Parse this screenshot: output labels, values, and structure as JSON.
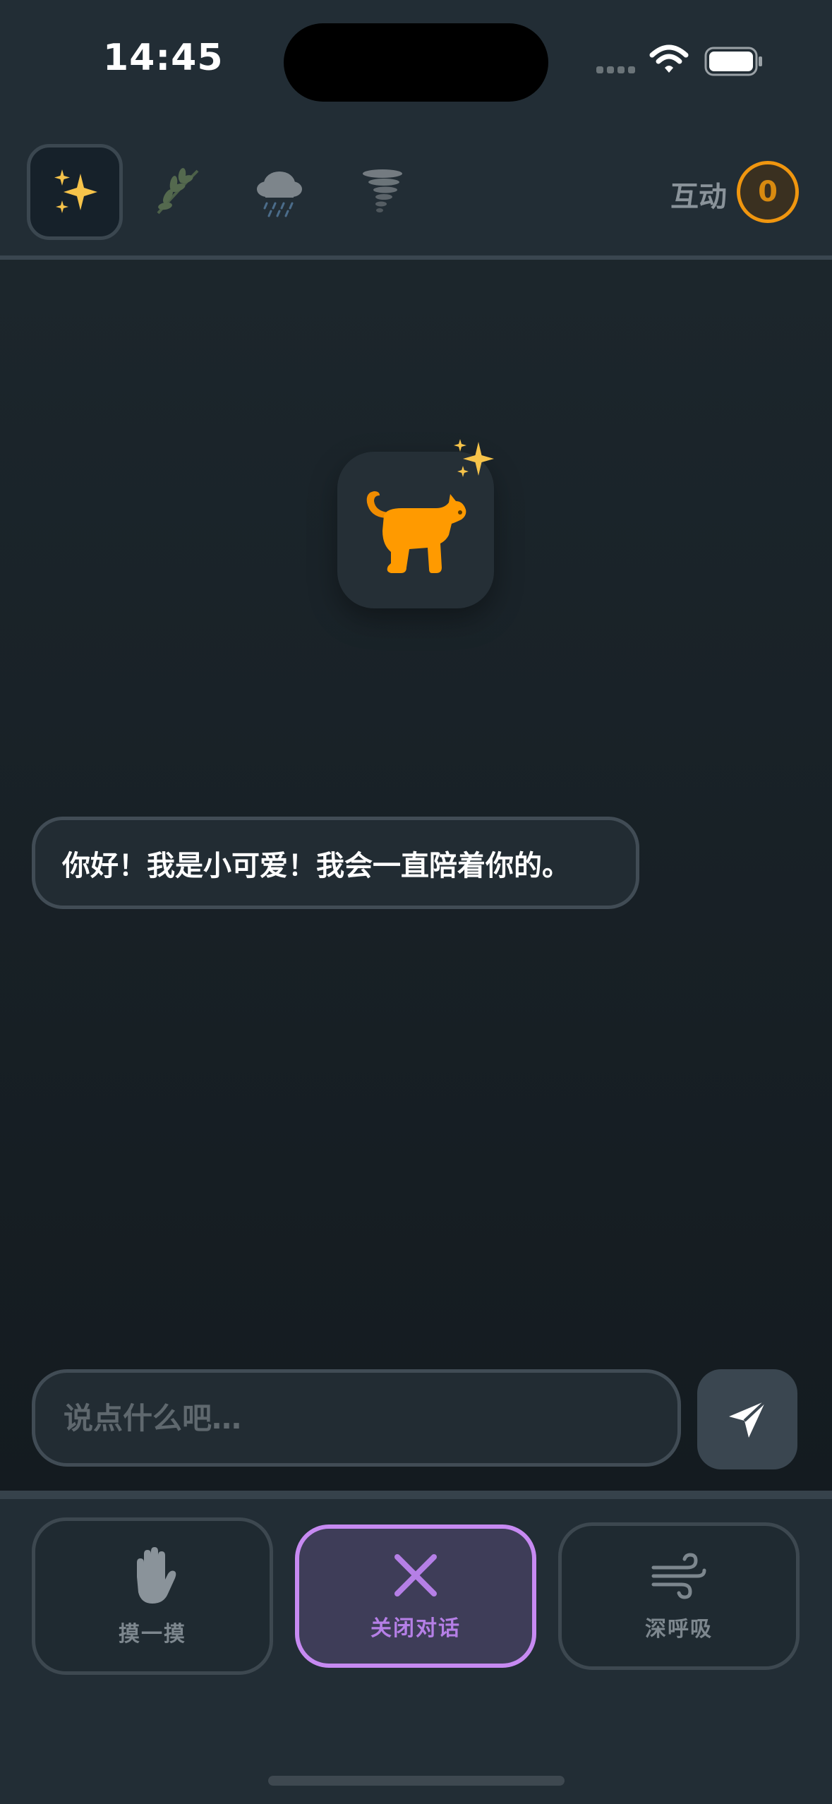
{
  "status": {
    "time": "14:45"
  },
  "header": {
    "mode_tabs": [
      {
        "icon": "sparkles-icon",
        "active": true
      },
      {
        "icon": "leaf-icon",
        "active": false
      },
      {
        "icon": "rain-cloud-icon",
        "active": false
      },
      {
        "icon": "tornado-icon",
        "active": false
      }
    ],
    "interaction_label": "互动",
    "interaction_count": "0"
  },
  "pet": {
    "icon": "cat-icon",
    "badge": "sparkles-icon"
  },
  "chat": {
    "message": "你好！我是小可爱！我会一直陪着你的。"
  },
  "input": {
    "placeholder": "说点什么吧…",
    "value": ""
  },
  "actions": [
    {
      "label": "摸一摸",
      "icon": "hand-icon"
    },
    {
      "label": "关闭对话",
      "icon": "close-icon",
      "active": true
    },
    {
      "label": "深呼吸",
      "icon": "wind-icon"
    }
  ],
  "colors": {
    "accent_orange": "#f0960f",
    "accent_purple": "#c78af2",
    "background": "#1b252c"
  }
}
